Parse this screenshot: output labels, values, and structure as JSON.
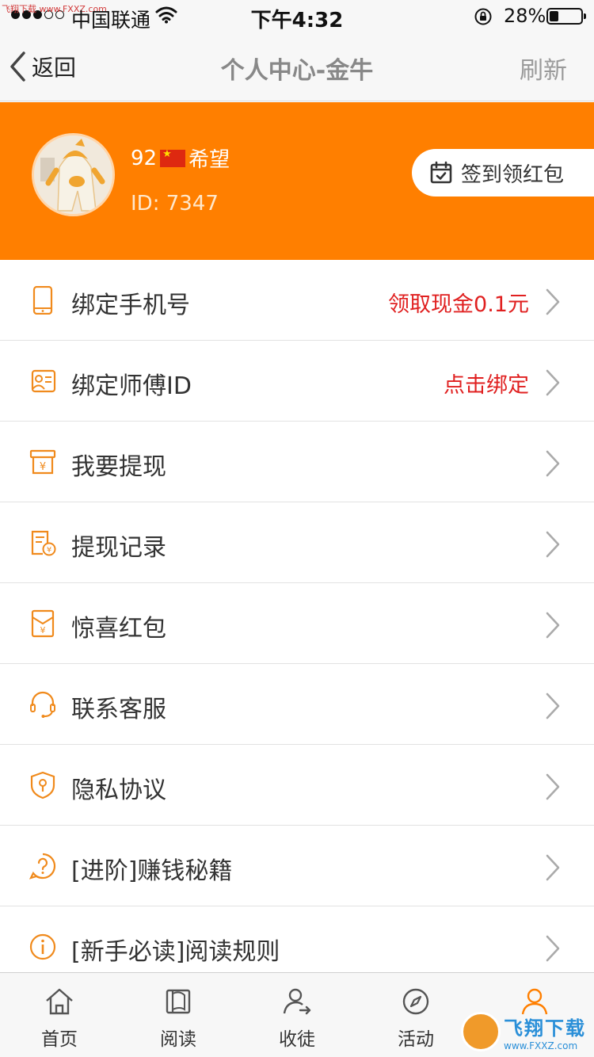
{
  "watermark": {
    "top": "飞翔下载 www.FXXZ.com",
    "brand": "飞翔下载",
    "url": "www.FXXZ.com"
  },
  "status_bar": {
    "carrier": "中国联通",
    "time": "下午4:32",
    "battery_percent": "28%",
    "battery_level": 0.28
  },
  "nav": {
    "back_label": "返回",
    "title": "个人中心-金牛",
    "refresh_label": "刷新"
  },
  "profile": {
    "name_prefix": "92",
    "name_suffix": "希望",
    "user_id": "ID: 7347",
    "signin_label": "签到领红包",
    "background_color": "#ff7f00"
  },
  "menu": {
    "items": [
      {
        "label": "绑定手机号",
        "hint": "领取现金0.1元",
        "icon": "phone-icon"
      },
      {
        "label": "绑定师傅ID",
        "hint": "点击绑定",
        "icon": "id-card-icon"
      },
      {
        "label": "我要提现",
        "hint": "",
        "icon": "withdraw-icon"
      },
      {
        "label": "提现记录",
        "hint": "",
        "icon": "record-icon"
      },
      {
        "label": "惊喜红包",
        "hint": "",
        "icon": "red-envelope-icon"
      },
      {
        "label": "联系客服",
        "hint": "",
        "icon": "headset-icon"
      },
      {
        "label": "隐私协议",
        "hint": "",
        "icon": "shield-icon"
      },
      {
        "label": "[进阶]赚钱秘籍",
        "hint": "",
        "icon": "question-icon"
      },
      {
        "label": "[新手必读]阅读规则",
        "hint": "",
        "icon": "info-icon"
      }
    ]
  },
  "tabs": [
    {
      "label": "首页",
      "icon": "home-icon"
    },
    {
      "label": "阅读",
      "icon": "book-icon"
    },
    {
      "label": "收徒",
      "icon": "user-add-icon"
    },
    {
      "label": "活动",
      "icon": "compass-icon"
    },
    {
      "label": "",
      "icon": "person-icon"
    }
  ],
  "colors": {
    "accent": "#ff7f00",
    "hint_red": "#e02020"
  }
}
